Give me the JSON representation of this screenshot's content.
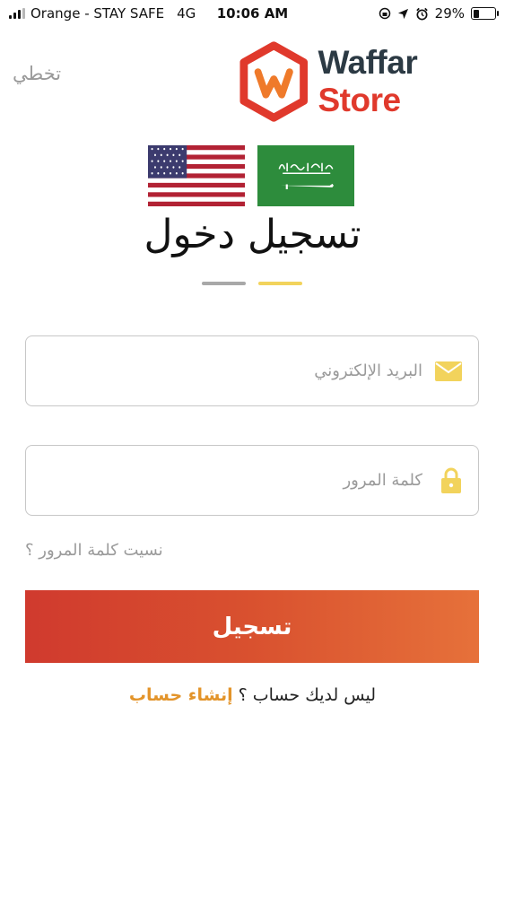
{
  "status_bar": {
    "carrier": "Orange - STAY SAFE",
    "network": "4G",
    "time": "10:06 AM",
    "battery": "29%",
    "battery_level": 0.29
  },
  "header": {
    "skip_label": "تخطي",
    "logo_word1": "Waffar",
    "logo_word2": "Store"
  },
  "languages": {
    "en_flag": "us-flag-icon",
    "ar_flag": "saudi-flag-icon"
  },
  "page": {
    "title": "تسجيل دخول"
  },
  "form": {
    "email_placeholder": "البريد الإلكتروني",
    "email_value": "",
    "password_placeholder": "كلمة المرور",
    "password_value": "",
    "forgot_label": "نسيت كلمة المرور ؟",
    "login_label": "تسجيل"
  },
  "signup": {
    "question": "ليس لديك حساب ؟",
    "link": "إنشاء حساب"
  },
  "colors": {
    "accent_yellow": "#f2d35c",
    "indicator_gray": "#a8a8a8",
    "brand_red": "#e0392c",
    "brand_dark": "#2c3a44",
    "link_orange": "#e3942a"
  }
}
